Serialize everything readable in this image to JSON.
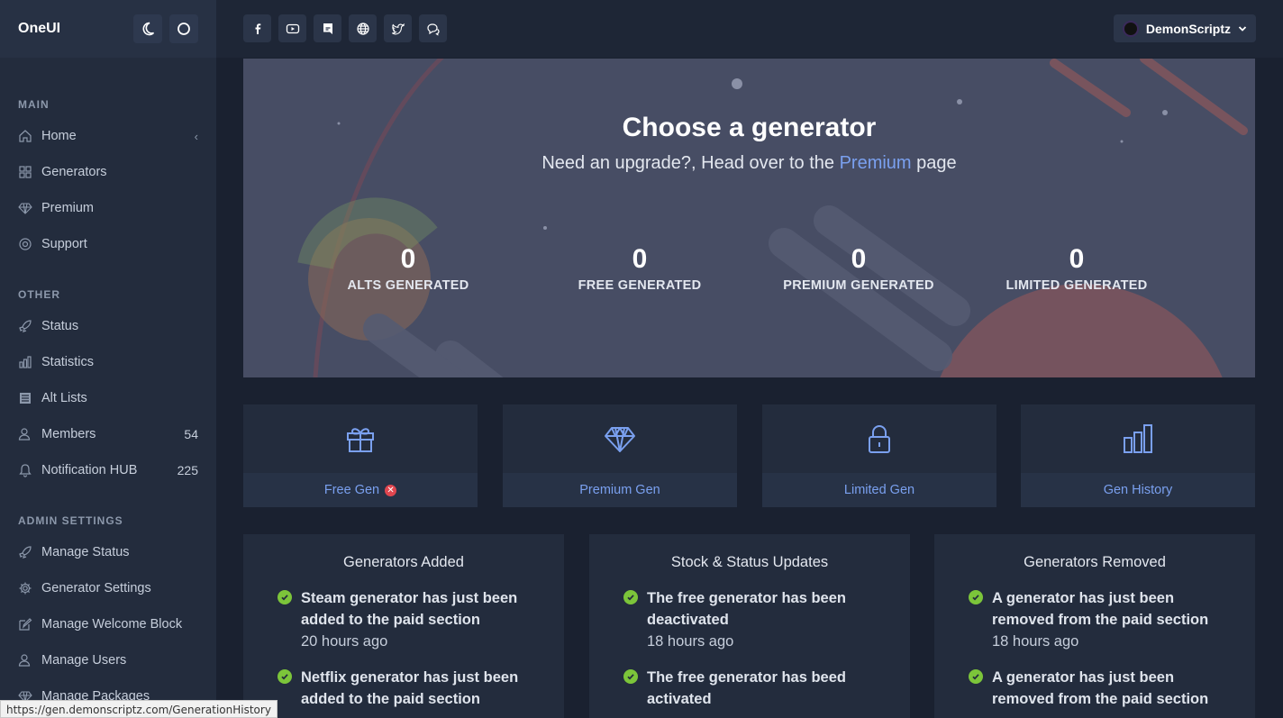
{
  "app": {
    "brand": "OneUI"
  },
  "topbar": {
    "social_icons": [
      "facebook-icon",
      "youtube-icon",
      "discord-icon",
      "globe-icon",
      "twitter-icon",
      "chat-icon"
    ],
    "user_name": "DemonScriptz"
  },
  "sidebar": {
    "main_label": "MAIN",
    "main_items": [
      {
        "label": "Home",
        "icon": "home-icon"
      },
      {
        "label": "Generators",
        "icon": "grid-icon"
      },
      {
        "label": "Premium",
        "icon": "diamond-icon"
      },
      {
        "label": "Support",
        "icon": "lifebuoy-icon"
      }
    ],
    "other_label": "OTHER",
    "other_items": [
      {
        "label": "Status",
        "icon": "rocket-icon"
      },
      {
        "label": "Statistics",
        "icon": "bar-chart-icon"
      },
      {
        "label": "Alt Lists",
        "icon": "list-icon"
      },
      {
        "label": "Members",
        "icon": "users-icon",
        "badge": "54"
      },
      {
        "label": "Notification HUB",
        "icon": "bell-icon",
        "badge": "225"
      }
    ],
    "admin_label": "ADMIN SETTINGS",
    "admin_items": [
      {
        "label": "Manage Status",
        "icon": "rocket-icon"
      },
      {
        "label": "Generator Settings",
        "icon": "gear-icon"
      },
      {
        "label": "Manage Welcome Block",
        "icon": "edit-icon"
      },
      {
        "label": "Manage Users",
        "icon": "users-icon"
      },
      {
        "label": "Manage Packages",
        "icon": "diamond-icon"
      }
    ]
  },
  "hero": {
    "title": "Choose a generator",
    "subtitle_before": "Need an upgrade?, Head over to the ",
    "subtitle_link": "Premium",
    "subtitle_after": " page",
    "stats": [
      {
        "value": "0",
        "label": "ALTS GENERATED"
      },
      {
        "value": "0",
        "label": "FREE GENERATED"
      },
      {
        "value": "0",
        "label": "PREMIUM GENERATED"
      },
      {
        "value": "0",
        "label": "LIMITED GENERATED"
      }
    ]
  },
  "cards": [
    {
      "label": "Free Gen",
      "icon": "gift-icon",
      "disabled": true
    },
    {
      "label": "Premium Gen",
      "icon": "diamond-icon"
    },
    {
      "label": "Limited Gen",
      "icon": "lock-icon"
    },
    {
      "label": "Gen History",
      "icon": "bar-chart-icon"
    }
  ],
  "panels": [
    {
      "title": "Generators Added",
      "entries": [
        {
          "text": "Steam generator has just been added to the paid section",
          "time": "20 hours ago"
        },
        {
          "text": "Netflix generator has just been added to the paid section",
          "time": ""
        }
      ]
    },
    {
      "title": "Stock & Status Updates",
      "entries": [
        {
          "text": "The free generator has been deactivated",
          "time": "18 hours ago"
        },
        {
          "text": "The free generator has beed activated",
          "time": ""
        }
      ]
    },
    {
      "title": "Generators Removed",
      "entries": [
        {
          "text": "A generator has just been removed from the paid section",
          "time": "18 hours ago"
        },
        {
          "text": "A generator has just been removed from the paid section",
          "time": ""
        }
      ]
    }
  ],
  "statusbar": {
    "url": "https://gen.demonscriptz.com/GenerationHistory"
  },
  "colors": {
    "accent": "#7aa0ef",
    "success": "#7cc53a",
    "danger": "#e0464f",
    "hero_bg": "#474d64"
  }
}
